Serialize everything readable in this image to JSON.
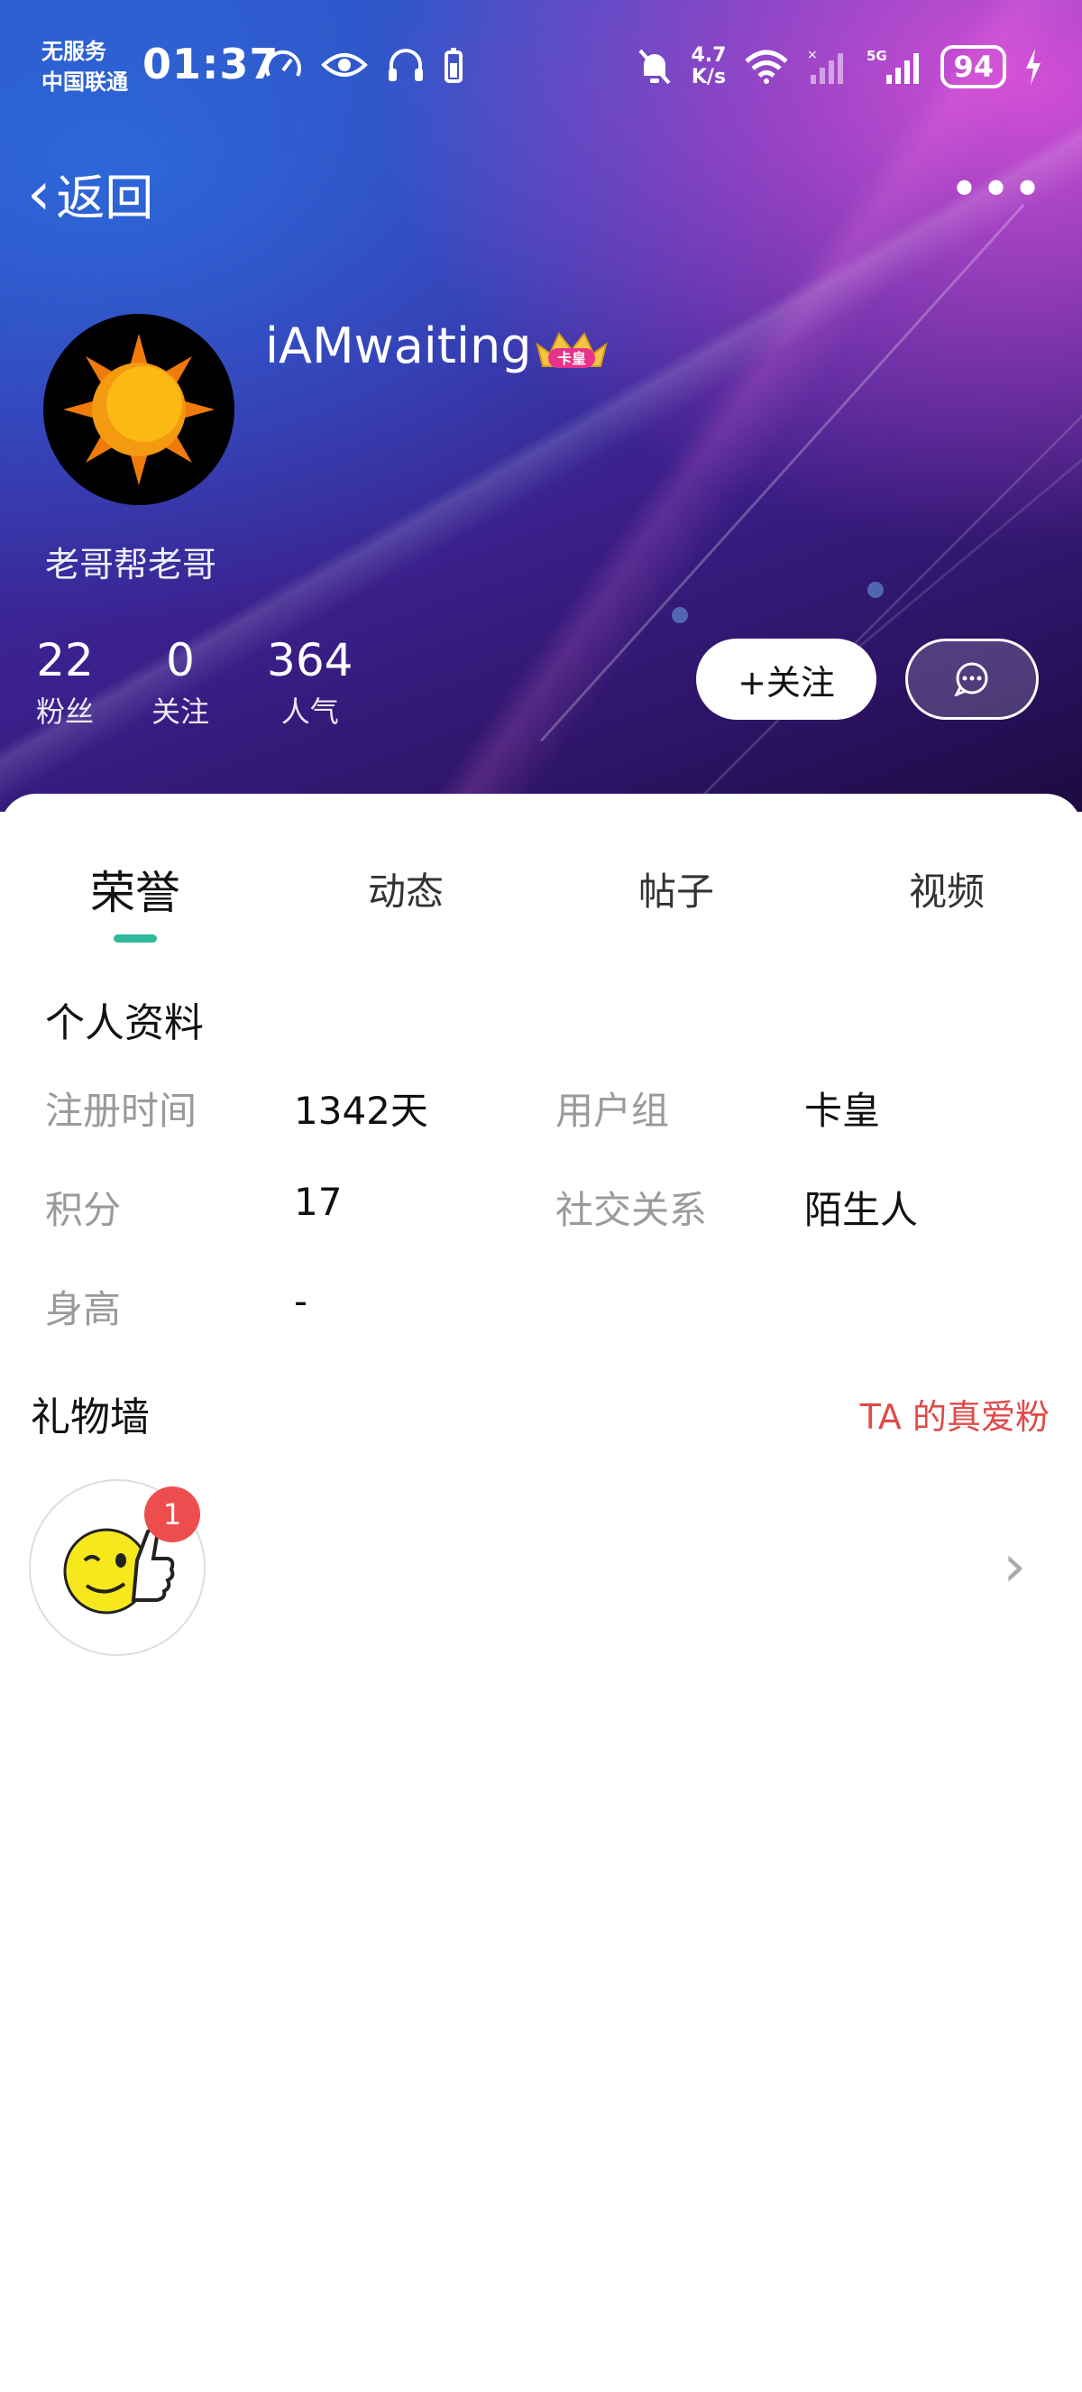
{
  "status_bar": {
    "carrier_line1": "无服务",
    "carrier_line2": "中国联通",
    "time": "01:37",
    "net_speed_value": "4.7",
    "net_speed_unit": "K/s",
    "network": "5G",
    "battery": "94"
  },
  "nav": {
    "back_label": "返回",
    "more_label": "•••"
  },
  "profile": {
    "username": "iAMwaiting",
    "badge_text": "卡皇",
    "signature": "老哥帮老哥",
    "stats": [
      {
        "value": "22",
        "label": "粉丝"
      },
      {
        "value": "0",
        "label": "关注"
      },
      {
        "value": "364",
        "label": "人气"
      }
    ],
    "follow_label": "+关注"
  },
  "tabs": [
    {
      "label": "荣誉",
      "active": true
    },
    {
      "label": "动态",
      "active": false
    },
    {
      "label": "帖子",
      "active": false
    },
    {
      "label": "视频",
      "active": false
    }
  ],
  "profile_info": {
    "title": "个人资料",
    "fields": {
      "reg_time": {
        "label": "注册时间",
        "value": "1342天"
      },
      "user_group": {
        "label": "用户组",
        "value": "卡皇"
      },
      "points": {
        "label": "积分",
        "value": "17"
      },
      "relation": {
        "label": "社交关系",
        "value": "陌生人"
      },
      "height": {
        "label": "身高",
        "value": "-"
      }
    }
  },
  "gift_wall": {
    "title": "礼物墙",
    "link": "TA 的真爱粉",
    "gifts": [
      {
        "icon": "thumbs-up-smiley-icon",
        "count": "1"
      }
    ]
  },
  "colors": {
    "accent_tab": "#2fb99a",
    "link_red": "#e04a4a",
    "badge_red": "#ee4d4d"
  }
}
